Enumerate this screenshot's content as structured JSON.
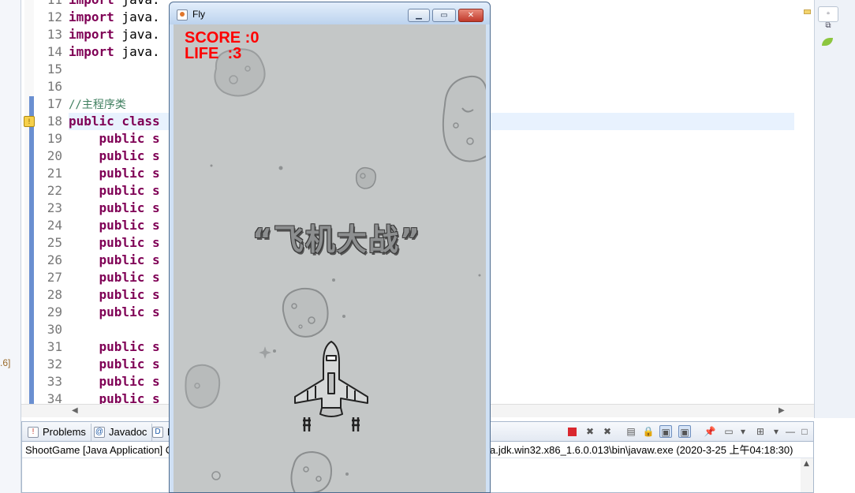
{
  "editor": {
    "line_numbers": [
      "11",
      "12",
      "13",
      "14",
      "15",
      "16",
      "17",
      "18",
      "19",
      "20",
      "21",
      "22",
      "23",
      "24",
      "25",
      "26",
      "27",
      "28",
      "29",
      "30",
      "31",
      "32",
      "33",
      "34"
    ],
    "lines": [
      {
        "kw": "import",
        "rest": " java."
      },
      {
        "kw": "import",
        "rest": " java."
      },
      {
        "kw": "import",
        "rest": " java."
      },
      {
        "kw": "import",
        "rest": " java."
      },
      {
        "kw": "",
        "rest": ""
      },
      {
        "kw": "",
        "rest": ""
      },
      {
        "kw": "",
        "rest": "",
        "comment": "//主程序类"
      },
      {
        "kw": "public class",
        "rest": ""
      },
      {
        "kw": "    public s",
        "rest": ""
      },
      {
        "kw": "    public s",
        "rest": ""
      },
      {
        "kw": "    public s",
        "rest": ""
      },
      {
        "kw": "    public s",
        "rest": ""
      },
      {
        "kw": "    public s",
        "rest": ""
      },
      {
        "kw": "    public s",
        "rest": ""
      },
      {
        "kw": "    public s",
        "rest": ""
      },
      {
        "kw": "    public s",
        "rest": ""
      },
      {
        "kw": "    public s",
        "rest": ""
      },
      {
        "kw": "    public s",
        "rest": ""
      },
      {
        "kw": "    public s",
        "rest": ""
      },
      {
        "kw": "",
        "rest": ""
      },
      {
        "kw": "    public s",
        "rest": ""
      },
      {
        "kw": "    public s",
        "rest": ""
      },
      {
        "kw": "    public s",
        "rest": ""
      },
      {
        "kw": "    public s",
        "rest": ""
      }
    ],
    "left_edge_text": ".6]"
  },
  "console": {
    "tabs": [
      {
        "label": "Problems",
        "icon": "problems-icon"
      },
      {
        "label": "Javadoc",
        "icon": "javadoc-icon"
      },
      {
        "label": "D",
        "icon": "declaration-icon"
      }
    ],
    "header_left": "ShootGame [Java Application] C",
    "header_right": "a.jdk.win32.x86_1.6.0.013\\bin\\javaw.exe (2020-3-25 上午04:18:30)"
  },
  "fly_window": {
    "title": "Fly",
    "minimize_icon": "minimize-icon",
    "maximize_icon": "maximize-icon",
    "close_icon": "close-icon",
    "score_text": "SCORE :0",
    "life_text": "LIFE  :3",
    "game_title": "“飞机大战”",
    "score": 0,
    "life": 3
  },
  "colors": {
    "hud_red": "#ff0000",
    "canvas_bg": "#c4c7c7",
    "keyword": "#7f0055",
    "comment": "#3f7f5f"
  }
}
